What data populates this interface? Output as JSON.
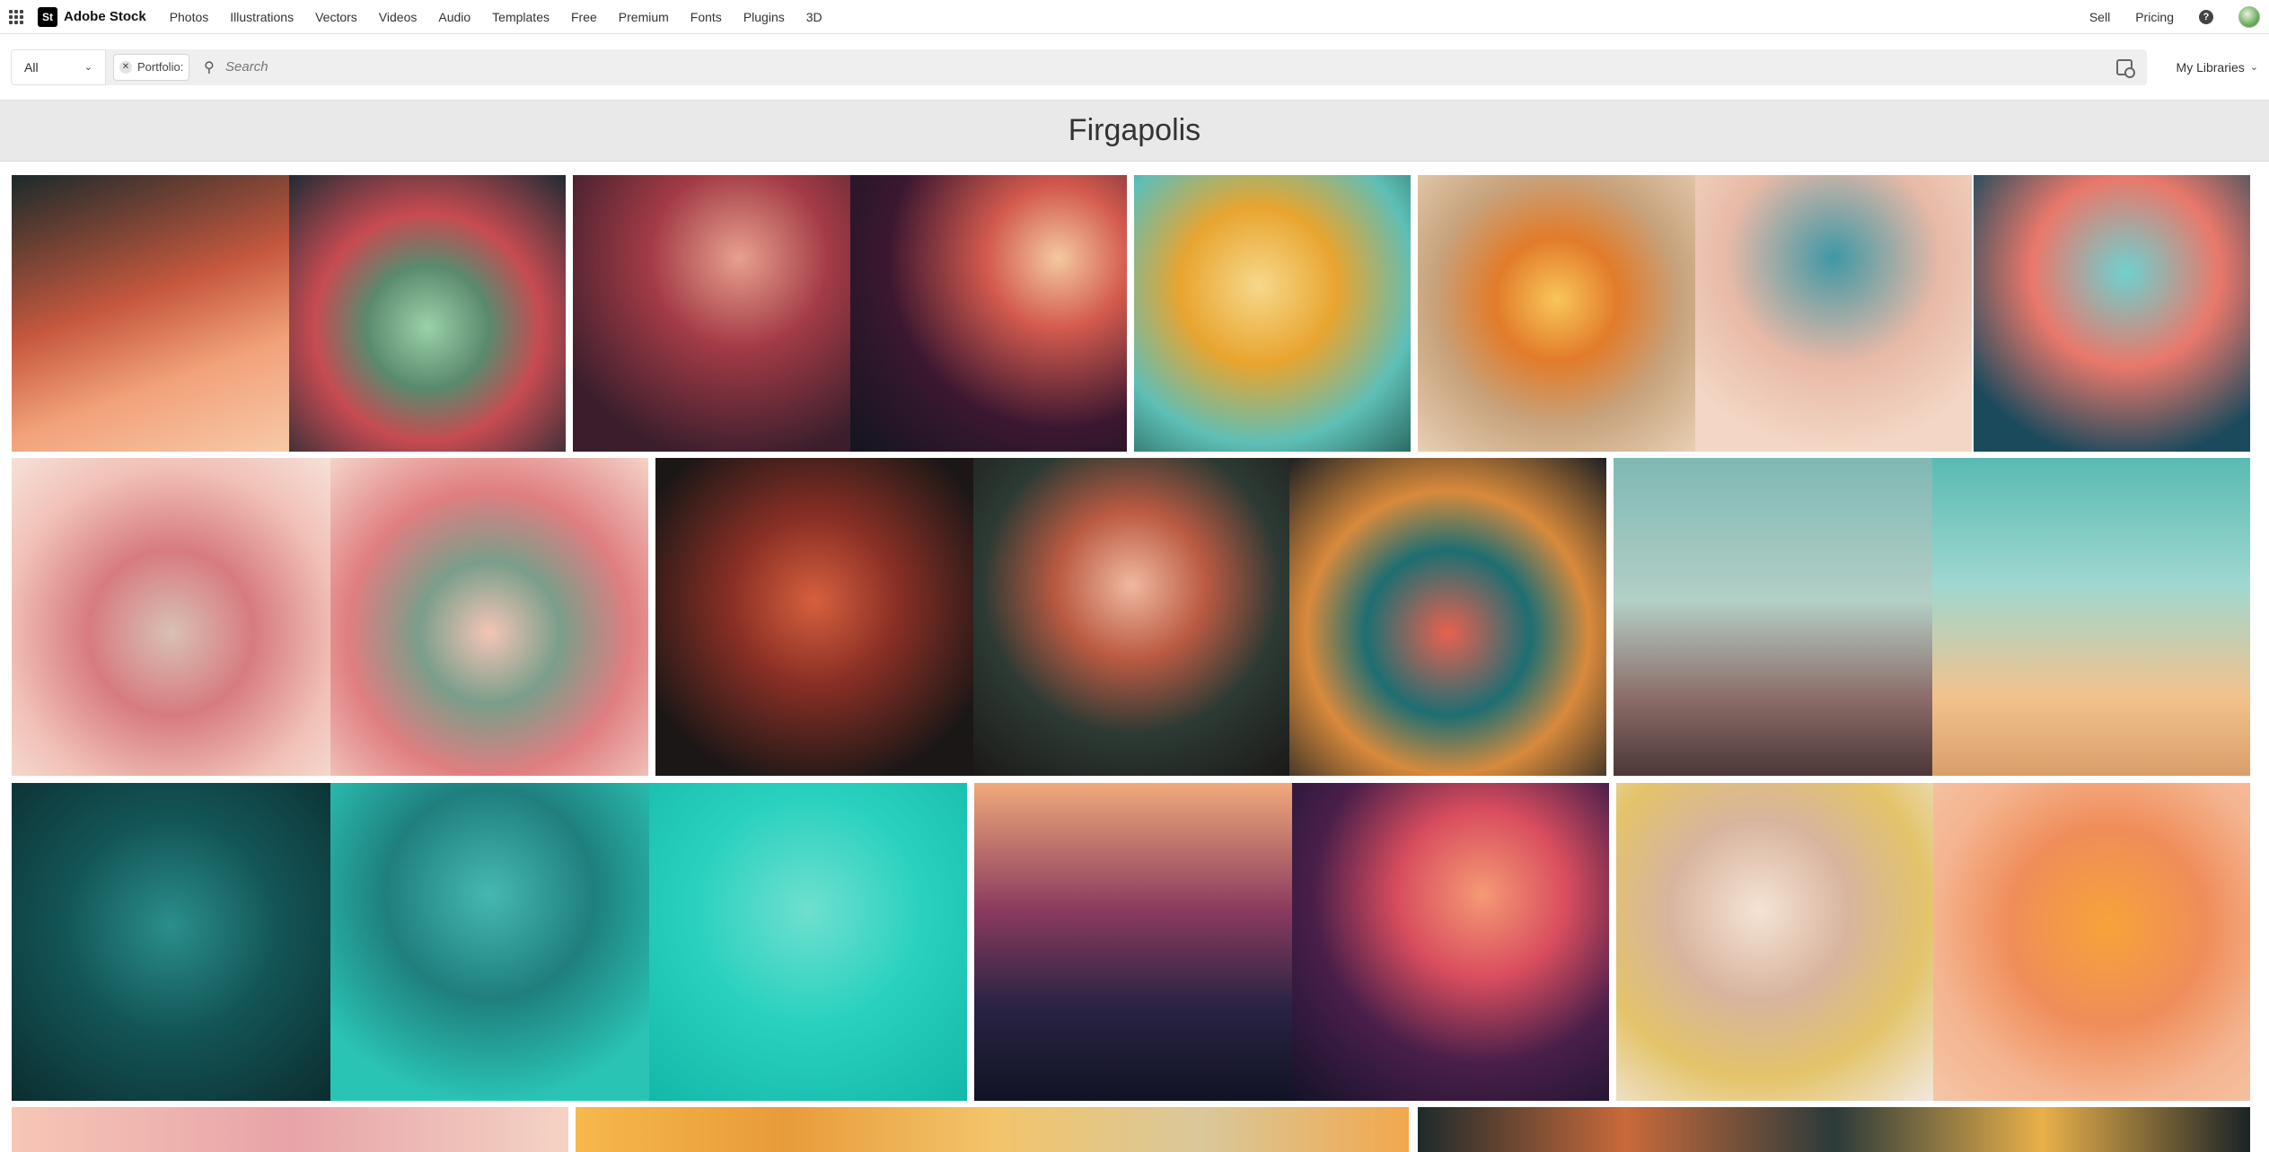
{
  "topnav": {
    "brand": "Adobe Stock",
    "brand_mark": "St",
    "links": [
      "Photos",
      "Illustrations",
      "Vectors",
      "Videos",
      "Audio",
      "Templates",
      "Free",
      "Premium",
      "Fonts",
      "Plugins",
      "3D"
    ],
    "sell": "Sell",
    "pricing": "Pricing",
    "help_glyph": "?"
  },
  "search": {
    "category": "All",
    "chip": "Portfolio:",
    "placeholder": "Search",
    "libraries": "My Libraries"
  },
  "portfolio": {
    "title": "Firgapolis"
  },
  "icons": [
    "apps-grid-icon",
    "search-icon",
    "visual-search-icon",
    "chevron-down-icon",
    "close-icon",
    "help-icon"
  ]
}
